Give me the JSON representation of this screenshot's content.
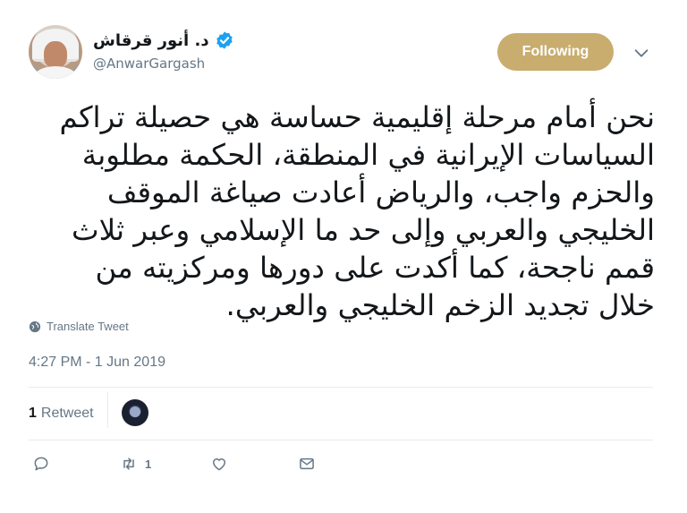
{
  "author": {
    "display_name": "د. أنور قرقاش",
    "handle": "@AnwarGargash",
    "verified": true
  },
  "follow_button": {
    "label": "Following",
    "color": "#c9ad6f"
  },
  "tweet": {
    "text": "نحن أمام مرحلة إقليمية حساسة هي حصيلة تراكم\nالسياسات الإيرانية في المنطقة، الحكمة مطلوبة\nوالحزم واجب، والرياض أعادت صياغة الموقف\nالخليجي والعربي وإلى حد ما الإسلامي وعبر ثلاث\nقمم ناجحة، كما أكدت على دورها ومركزيته من\nخلال تجديد الزخم الخليجي والعربي.",
    "translate_label": "Translate Tweet",
    "timestamp": "4:27 PM - 1 Jun 2019"
  },
  "stats": {
    "retweet_count": "1",
    "retweet_label": "Retweet"
  },
  "actions": {
    "reply_icon": "reply-icon",
    "retweet_icon": "retweet-icon",
    "retweet_count": "1",
    "like_icon": "heart-icon",
    "message_icon": "envelope-icon"
  },
  "colors": {
    "verified": "#1da1f2",
    "muted": "#657786",
    "text": "#14171a"
  }
}
